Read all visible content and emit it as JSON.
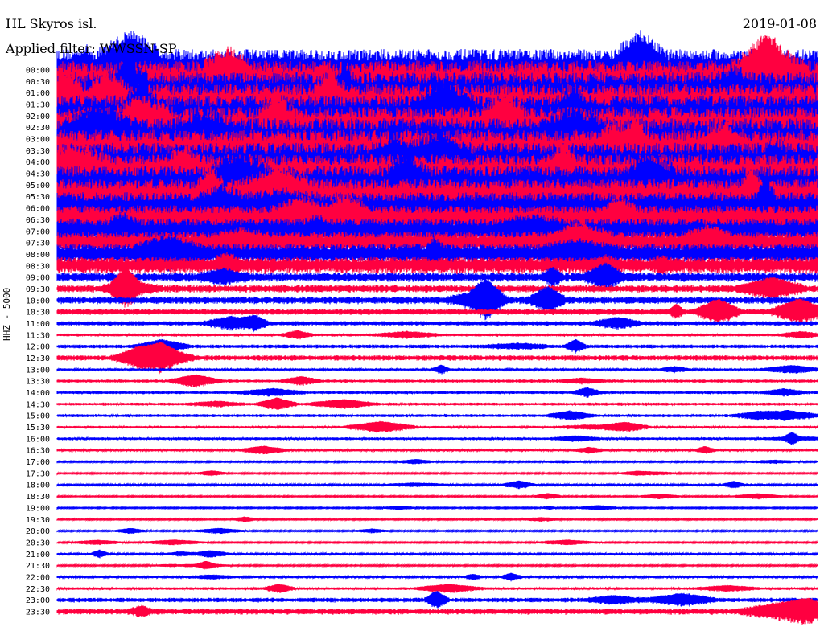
{
  "header": {
    "station": "HL Skyros isl.",
    "date": "2019-01-08",
    "filter": "Applied filter: WWSSN-SP"
  },
  "chart_data": {
    "type": "line",
    "title": "HL Skyros isl.",
    "ylabel": "HHZ - 5000",
    "colors": [
      "#0000ff",
      "#ff0040"
    ],
    "rows": [
      {
        "label": "00:00",
        "amp": 26
      },
      {
        "label": "00:30",
        "amp": 26
      },
      {
        "label": "01:00",
        "amp": 26
      },
      {
        "label": "01:30",
        "amp": 26
      },
      {
        "label": "02:00",
        "amp": 26
      },
      {
        "label": "02:30",
        "amp": 26
      },
      {
        "label": "03:00",
        "amp": 26
      },
      {
        "label": "03:30",
        "amp": 26
      },
      {
        "label": "04:00",
        "amp": 24
      },
      {
        "label": "04:30",
        "amp": 24
      },
      {
        "label": "05:00",
        "amp": 24
      },
      {
        "label": "05:30",
        "amp": 22
      },
      {
        "label": "06:00",
        "amp": 20
      },
      {
        "label": "06:30",
        "amp": 18
      },
      {
        "label": "07:00",
        "amp": 16
      },
      {
        "label": "07:30",
        "amp": 14
      },
      {
        "label": "08:00",
        "amp": 13
      },
      {
        "label": "08:30",
        "amp": 11
      },
      {
        "label": "09:00",
        "amp": 6
      },
      {
        "label": "09:30",
        "amp": 5
      },
      {
        "label": "10:00",
        "amp": 5
      },
      {
        "label": "10:30",
        "amp": 4
      },
      {
        "label": "11:00",
        "amp": 3
      },
      {
        "label": "11:30",
        "amp": 2
      },
      {
        "label": "12:00",
        "amp": 2.5
      },
      {
        "label": "12:30",
        "amp": 3.5
      },
      {
        "label": "13:00",
        "amp": 1.5
      },
      {
        "label": "13:30",
        "amp": 2
      },
      {
        "label": "14:00",
        "amp": 2
      },
      {
        "label": "14:30",
        "amp": 2
      },
      {
        "label": "15:00",
        "amp": 2
      },
      {
        "label": "15:30",
        "amp": 1.8
      },
      {
        "label": "16:00",
        "amp": 1.8
      },
      {
        "label": "16:30",
        "amp": 1.5
      },
      {
        "label": "17:00",
        "amp": 1
      },
      {
        "label": "17:30",
        "amp": 1
      },
      {
        "label": "18:00",
        "amp": 1.3
      },
      {
        "label": "18:30",
        "amp": 1
      },
      {
        "label": "19:00",
        "amp": 1
      },
      {
        "label": "19:30",
        "amp": 1
      },
      {
        "label": "20:00",
        "amp": 1
      },
      {
        "label": "20:30",
        "amp": 1
      },
      {
        "label": "21:00",
        "amp": 1.4
      },
      {
        "label": "21:30",
        "amp": 1
      },
      {
        "label": "22:00",
        "amp": 1.4
      },
      {
        "label": "22:30",
        "amp": 1.8
      },
      {
        "label": "23:00",
        "amp": 3
      },
      {
        "label": "23:30",
        "amp": 4
      }
    ]
  }
}
